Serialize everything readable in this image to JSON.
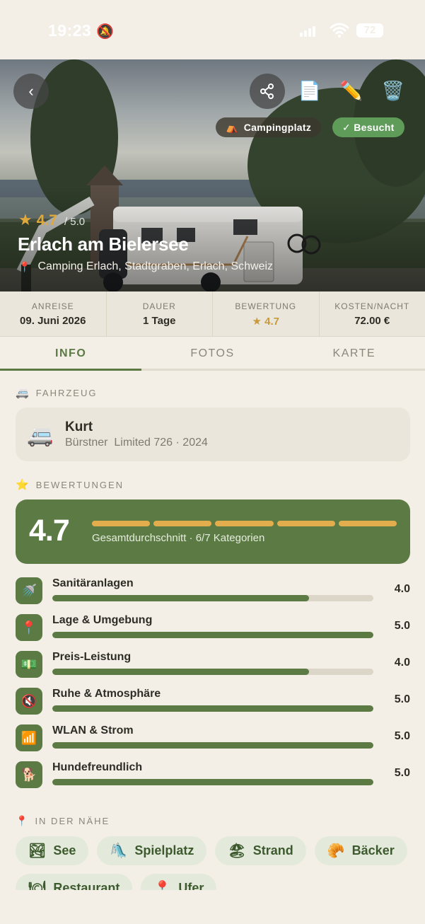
{
  "statusbar": {
    "time": "19:23",
    "battery": "72"
  },
  "hero": {
    "category_pill": {
      "emoji": "⛺",
      "label": "Campingplatz"
    },
    "visited_pill": {
      "label": "✓ Besucht"
    },
    "rating": {
      "value": "4.7",
      "max": "/ 5.0"
    },
    "title": "Erlach am Bielersee",
    "address": "Camping Erlach, Stadtgraben, Erlach, Schweiz"
  },
  "stats": [
    {
      "label": "ANREISE",
      "value": "09. Juni 2026"
    },
    {
      "label": "DAUER",
      "value": "1 Tage"
    },
    {
      "label": "BEWERTUNG",
      "value": "★ 4.7"
    },
    {
      "label": "KOSTEN/NACHT",
      "value": "72.00 €"
    }
  ],
  "tabs": [
    {
      "label": "INFO"
    },
    {
      "label": "FOTOS"
    },
    {
      "label": "KARTE"
    }
  ],
  "vehicle_section": {
    "heading": "FAHRZEUG",
    "name": "Kurt",
    "details": "Bürstner  Limited 726 · 2024"
  },
  "ratings_section": {
    "heading": "BEWERTUNGEN",
    "overall": "4.7",
    "caption": "Gesamtdurchschnitt · 6/7 Kategorien",
    "categories": [
      {
        "label": "Sanitäranlagen",
        "icon": "shower-icon",
        "emoji": "🚿",
        "score": "4.0",
        "fraction": 0.8
      },
      {
        "label": "Lage & Umgebung",
        "icon": "location-pin-icon",
        "emoji": "📍",
        "score": "5.0",
        "fraction": 1.0
      },
      {
        "label": "Preis-Leistung",
        "icon": "money-icon",
        "emoji": "💵",
        "score": "4.0",
        "fraction": 0.8
      },
      {
        "label": "Ruhe & Atmosphäre",
        "icon": "muted-speaker-icon",
        "emoji": "🔇",
        "score": "5.0",
        "fraction": 1.0
      },
      {
        "label": "WLAN & Strom",
        "icon": "wifi-icon",
        "emoji": "📶",
        "score": "5.0",
        "fraction": 1.0
      },
      {
        "label": "Hundefreundlich",
        "icon": "dog-icon",
        "emoji": "🐕",
        "score": "5.0",
        "fraction": 1.0
      }
    ]
  },
  "nearby_section": {
    "heading": "IN DER NÄHE",
    "chips": [
      {
        "label": "See",
        "emoji": "🏞",
        "icon": "lake-icon"
      },
      {
        "label": "Spielplatz",
        "emoji": "🛝",
        "icon": "playground-icon"
      },
      {
        "label": "Strand",
        "emoji": "🏖",
        "icon": "beach-icon"
      },
      {
        "label": "Bäcker",
        "emoji": "🥐",
        "icon": "croissant-icon"
      },
      {
        "label": "Restaurant",
        "emoji": "🍽",
        "icon": "restaurant-icon"
      },
      {
        "label": "Ufer",
        "emoji": "📍",
        "icon": "location-pin-icon"
      }
    ]
  },
  "colors": {
    "accent": "#5b7a44",
    "gold": "#e1ad4d",
    "background": "#f3efe6",
    "visited": "#5f9c5a"
  }
}
